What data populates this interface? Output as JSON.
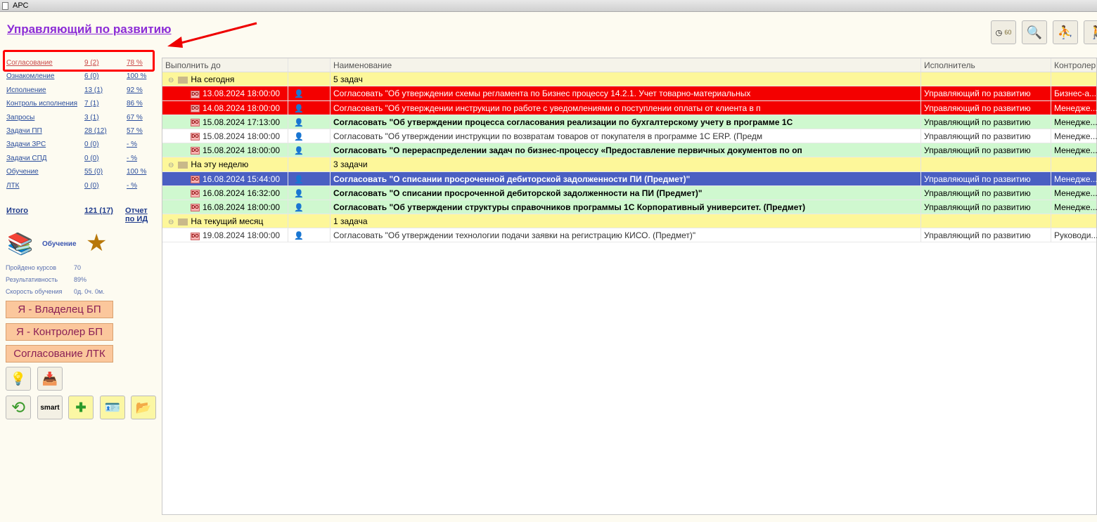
{
  "window": {
    "title": "АРС"
  },
  "page_title": "Управляющий по развитию",
  "stats": [
    {
      "name": "Согласование",
      "count": "9 (2)",
      "pct": "78 %"
    },
    {
      "name": "Ознакомление",
      "count": "6 (0)",
      "pct": "100 %"
    },
    {
      "name": "Исполнение",
      "count": "13 (1)",
      "pct": "92 %"
    },
    {
      "name": "Контроль исполнения",
      "count": "7 (1)",
      "pct": "86 %"
    },
    {
      "name": "Запросы",
      "count": "3 (1)",
      "pct": "67 %"
    },
    {
      "name": "Задачи ПП",
      "count": "28 (12)",
      "pct": "57 %"
    },
    {
      "name": "Задачи ЗРС",
      "count": "0 (0)",
      "pct": "- %"
    },
    {
      "name": "Задачи СПД",
      "count": "0 (0)",
      "pct": "- %"
    },
    {
      "name": "Обучение",
      "count": "55 (0)",
      "pct": "100 %"
    },
    {
      "name": "ЛТК",
      "count": "0 (0)",
      "pct": "- %"
    }
  ],
  "total": {
    "label": "Итого",
    "count": "121 (17)",
    "report_line1": "Отчет",
    "report_line2": "по ИД"
  },
  "learning": {
    "label": "Обучение",
    "courses_label": "Пройдено курсов",
    "courses": "70",
    "result_label": "Результативность",
    "result": "89%",
    "speed_label": "Скорость обучения",
    "speed": "0д. 0ч. 0м."
  },
  "buttons": {
    "owner": "Я - Владелец БП",
    "controller": "Я - Контролер БП",
    "ltk": "Согласование ЛТК",
    "smart": "smart"
  },
  "toolbar": {
    "timer": "60"
  },
  "table": {
    "columns": [
      "Выполнить до",
      "",
      "Наименование",
      "Исполнитель",
      "Контролер"
    ],
    "rows": [
      {
        "type": "grp",
        "group": "На сегодня",
        "count": "5 задач"
      },
      {
        "type": "red",
        "date": "13.08.2024 18:00:00",
        "name": "Согласовать \"Об утверждении схемы регламента по Бизнес процессу 14.2.1. Учет товарно-материальных",
        "exec": "Управляющий по развитию",
        "ctrl": "Бизнес-а..."
      },
      {
        "type": "red",
        "date": "14.08.2024 18:00:00",
        "name": "Согласовать \"Об утверждении инструкции по работе с уведомлениями о поступлении оплаты от клиента в п",
        "exec": "Управляющий по развитию",
        "ctrl": "Менедже..."
      },
      {
        "type": "green",
        "date": "15.08.2024 17:13:00",
        "name": "Согласовать \"Об утверждении процесса согласования реализации по бухгалтерскому учету в программе 1С",
        "exec": "Управляющий по развитию",
        "ctrl": "Менедже..."
      },
      {
        "type": "white",
        "date": "15.08.2024 18:00:00",
        "name": "Согласовать \"Об утверждении инструкции по возвратам товаров от покупателя в программе 1С ERP. (Предм",
        "exec": "Управляющий по развитию",
        "ctrl": "Менедже..."
      },
      {
        "type": "green",
        "date": "15.08.2024 18:00:00",
        "name": "Согласовать \"О перераспределении задач по бизнес-процессу «Предоставление первичных документов по оп",
        "exec": "Управляющий по развитию",
        "ctrl": "Менедже..."
      },
      {
        "type": "grp",
        "group": "На эту неделю",
        "count": "3 задачи"
      },
      {
        "type": "blue",
        "date": "16.08.2024 15:44:00",
        "name": "Согласовать \"О списании просроченной дебиторской задолженности ПИ (Предмет)\"",
        "exec": "Управляющий по развитию",
        "ctrl": "Менедже..."
      },
      {
        "type": "green",
        "date": "16.08.2024 16:32:00",
        "name": "Согласовать \"О списании просроченной дебиторской задолженности на ПИ (Предмет)\"",
        "exec": "Управляющий по развитию",
        "ctrl": "Менедже..."
      },
      {
        "type": "green",
        "date": "16.08.2024 18:00:00",
        "name": "Согласовать \"Об утверждении структуры справочников программы 1С Корпоративный университет. (Предмет)",
        "exec": "Управляющий по развитию",
        "ctrl": "Менедже..."
      },
      {
        "type": "grp",
        "group": "На текущий месяц",
        "count": "1 задача"
      },
      {
        "type": "white",
        "date": "19.08.2024 18:00:00",
        "name": "Согласовать \"Об утверждении технологии подачи заявки на регистрацию КИСО. (Предмет)\"",
        "exec": "Управляющий по развитию",
        "ctrl": "Руководи..."
      }
    ]
  }
}
